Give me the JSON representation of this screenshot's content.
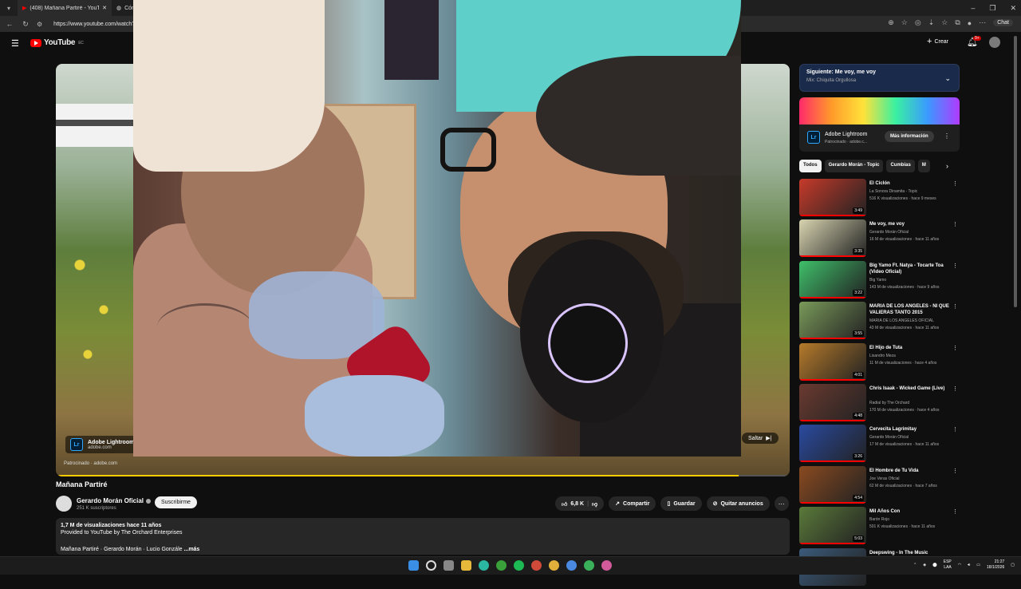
{
  "browser": {
    "tabs": [
      {
        "label": "(408) Mañana Partiré - YouTube",
        "active": true
      },
      {
        "label": "Cóm",
        "active": false
      }
    ],
    "url": "https://www.youtube.com/watch?v=",
    "chat_label": "Chat"
  },
  "header": {
    "logo_text": "YouTube",
    "region": "EC",
    "create_label": "Crear",
    "notifications_badge": "9+"
  },
  "player": {
    "ad_name": "Adobe Lightroom",
    "ad_domain": "adobe.com",
    "sponsored_text": "Patrocinado · adobe.com",
    "skip_label": "Saltar",
    "lr_logo": "Lr",
    "progress": 0.93
  },
  "video": {
    "title": "Mañana Partiré",
    "channel": "Gerardo Morán Oficial",
    "subscribers": "251 K suscriptores",
    "subscribe_label": "Suscribirme",
    "likes": "6,8 K",
    "share_label": "Compartir",
    "save_label": "Guardar",
    "remove_ads_label": "Quitar anuncios",
    "views_line": "1,7 M de visualizaciones  hace 11 años",
    "provided_line": "Provided to YouTube by The Orchard Enterprises",
    "desc_line": "Mañana Partiré · Gerardo Morán · Lucio Gonzále",
    "more_label": "...más"
  },
  "up_next": {
    "title": "Siguiente: Me voy, me voy",
    "subtitle": "Mix: Chiquita Orgullosa"
  },
  "side_ad": {
    "name": "Adobe Lightroom",
    "sub": "Patrocinado · adobe.c...",
    "button": "Más información",
    "logo": "Lr"
  },
  "chips": [
    "Todos",
    "Gerardo Morán - Topic",
    "Cumbias",
    "M"
  ],
  "related": [
    {
      "title": "El Ciclón",
      "channel": "La Sonora Dinamita - Topic",
      "meta": "516 K visualizaciones · hace 9 meses",
      "duration": "3:49",
      "color": "#c63a2a"
    },
    {
      "title": "Me voy, me voy",
      "channel": "Gerardo Morán Oficial",
      "meta": "16 M de visualizaciones · hace 11 años",
      "duration": "3:35",
      "color": "#d8d4b0"
    },
    {
      "title": "Big Yamo Ft. Natya - Tocarte Toa (Video Oficial)",
      "channel": "Big Yamo",
      "meta": "143 M de visualizaciones · hace 9 años",
      "duration": "3:22",
      "color": "#3fbf6a"
    },
    {
      "title": "MARIA DE LOS ANGELES - NI QUE VALIERAS TANTO  2015",
      "channel": "MARIA DE LOS ANGELES OFICIAL",
      "meta": "43 M de visualizaciones · hace 11 años",
      "duration": "3:55",
      "color": "#7a9a5a"
    },
    {
      "title": "El Hijo de Tuta",
      "channel": "Lisandro Meza",
      "meta": "11 M de visualizaciones · hace 4 años",
      "duration": "4:01",
      "color": "#b57a2a"
    },
    {
      "title": "Chris Isaak - Wicked Game (Live)",
      "channel": "Radial by The Orchard",
      "meta": "170 M de visualizaciones · hace 4 años",
      "duration": "4:48",
      "color": "#6a3a30"
    },
    {
      "title": "Cervecita Lagrimitay",
      "channel": "Gerardo Morán Oficial",
      "meta": "17 M de visualizaciones · hace 11 años",
      "duration": "3:26",
      "color": "#2a4aa0"
    },
    {
      "title": "El Hombre de Tu Vida",
      "channel": "Joe Veras Oficial",
      "meta": "62 M de visualizaciones · hace 7 años",
      "duration": "4:54",
      "color": "#8a4a20"
    },
    {
      "title": "Mil Años Con",
      "channel": "Barón Rojo",
      "meta": "501 K visualizaciones · hace 11 años",
      "duration": "5:03",
      "color": "#5a7a3a"
    },
    {
      "title": "Deepswing - In The Music",
      "channel": "",
      "meta": "",
      "duration": "",
      "color": "#3a5a7a"
    }
  ],
  "taskbar": {
    "lang": "ESP",
    "lang2": "LAA",
    "time": "21:27",
    "date": "18/1/2026"
  }
}
